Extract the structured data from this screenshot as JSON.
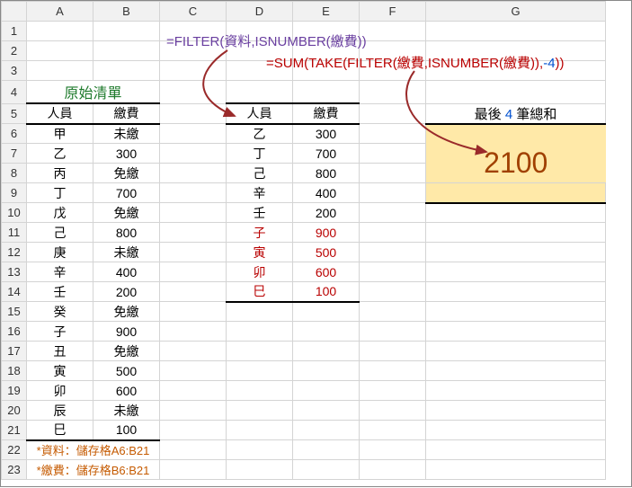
{
  "cols": [
    "A",
    "B",
    "C",
    "D",
    "E",
    "F",
    "G"
  ],
  "rows": [
    "1",
    "2",
    "3",
    "4",
    "5",
    "6",
    "7",
    "8",
    "9",
    "10",
    "11",
    "12",
    "13",
    "14",
    "15",
    "16",
    "17",
    "18",
    "19",
    "20",
    "21",
    "22",
    "23"
  ],
  "title_original": "原始清單",
  "header": {
    "person": "人員",
    "fee": "繳費"
  },
  "original": [
    {
      "p": "甲",
      "f": "未繳"
    },
    {
      "p": "乙",
      "f": "300"
    },
    {
      "p": "丙",
      "f": "免繳"
    },
    {
      "p": "丁",
      "f": "700"
    },
    {
      "p": "戊",
      "f": "免繳"
    },
    {
      "p": "己",
      "f": "800"
    },
    {
      "p": "庚",
      "f": "未繳"
    },
    {
      "p": "辛",
      "f": "400"
    },
    {
      "p": "壬",
      "f": "200"
    },
    {
      "p": "癸",
      "f": "免繳"
    },
    {
      "p": "子",
      "f": "900"
    },
    {
      "p": "丑",
      "f": "免繳"
    },
    {
      "p": "寅",
      "f": "500"
    },
    {
      "p": "卯",
      "f": "600"
    },
    {
      "p": "辰",
      "f": "未繳"
    },
    {
      "p": "巳",
      "f": "100"
    }
  ],
  "filtered": [
    {
      "p": "乙",
      "f": "300",
      "red": false
    },
    {
      "p": "丁",
      "f": "700",
      "red": false
    },
    {
      "p": "己",
      "f": "800",
      "red": false
    },
    {
      "p": "辛",
      "f": "400",
      "red": false
    },
    {
      "p": "壬",
      "f": "200",
      "red": false
    },
    {
      "p": "子",
      "f": "900",
      "red": true
    },
    {
      "p": "寅",
      "f": "500",
      "red": true
    },
    {
      "p": "卯",
      "f": "600",
      "red": true
    },
    {
      "p": "巳",
      "f": "100",
      "red": true
    }
  ],
  "formula1": "=FILTER(資料,ISNUMBER(繳費))",
  "formula2_a": "=SUM(TAKE(FILTER(繳費,ISNUMBER(繳費)),",
  "formula2_b": "-4",
  "formula2_c": "))",
  "sum_label_a": "最後 ",
  "sum_label_b": "4",
  "sum_label_c": " 筆總和",
  "sum_value": "2100",
  "note1": "*資料：儲存格A6:B21",
  "note2": "*繳費：儲存格B6:B21",
  "chart_data": {
    "type": "table",
    "original_list": {
      "columns": [
        "人員",
        "繳費"
      ],
      "rows": [
        [
          "甲",
          "未繳"
        ],
        [
          "乙",
          300
        ],
        [
          "丙",
          "免繳"
        ],
        [
          "丁",
          700
        ],
        [
          "戊",
          "免繳"
        ],
        [
          "己",
          800
        ],
        [
          "庚",
          "未繳"
        ],
        [
          "辛",
          400
        ],
        [
          "壬",
          200
        ],
        [
          "癸",
          "免繳"
        ],
        [
          "子",
          900
        ],
        [
          "丑",
          "免繳"
        ],
        [
          "寅",
          500
        ],
        [
          "卯",
          600
        ],
        [
          "辰",
          "未繳"
        ],
        [
          "巳",
          100
        ]
      ]
    },
    "filtered_list": {
      "columns": [
        "人員",
        "繳費"
      ],
      "rows": [
        [
          "乙",
          300
        ],
        [
          "丁",
          700
        ],
        [
          "己",
          800
        ],
        [
          "辛",
          400
        ],
        [
          "壬",
          200
        ],
        [
          "子",
          900
        ],
        [
          "寅",
          500
        ],
        [
          "卯",
          600
        ],
        [
          "巳",
          100
        ]
      ]
    },
    "last_4_sum": 2100
  }
}
